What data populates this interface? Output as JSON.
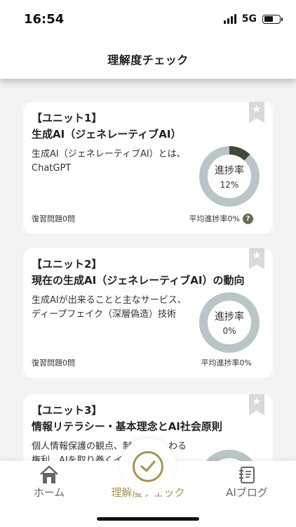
{
  "status_bar": {
    "time": "16:54",
    "network": "5G"
  },
  "header": {
    "title": "理解度チェック"
  },
  "units": [
    {
      "label": "【ユニット1】",
      "title": "生成AI（ジェネレーティブAI）",
      "description": "生成AI（ジェネレーティブAI）とは、ChatGPT",
      "review": "復習問題0問",
      "progress_label": "進捗率",
      "progress": "12%",
      "progress_value": 12,
      "average": "平均進捗率0%",
      "help_icon": "?"
    },
    {
      "label": "【ユニット2】",
      "title": "現在の生成AI（ジェネレーティブAI）の動向",
      "description": "生成AIが出来ることと主なサービス、ディープフェイク（深層偽造）技術",
      "review": "復習問題0問",
      "progress_label": "進捗率",
      "progress": "0%",
      "progress_value": 0,
      "average": "平均進捗率0%"
    },
    {
      "label": "【ユニット3】",
      "title": "情報リテラシー・基本理念とAI社会原則",
      "description": "個人情報保護の観点、制　　　　わる権利、AIを取り巻くイ"
    }
  ],
  "tabs": [
    {
      "label": "ホーム",
      "icon": "home-icon"
    },
    {
      "label": "理解度チェック",
      "icon": "check-circle-icon"
    },
    {
      "label": "AIブログ",
      "icon": "blog-icon"
    }
  ],
  "colors": {
    "accent": "#a6925a",
    "ring_track": "#b9c5c7",
    "ring_progress": "#3f4a3a",
    "background": "#f4f3f1"
  }
}
